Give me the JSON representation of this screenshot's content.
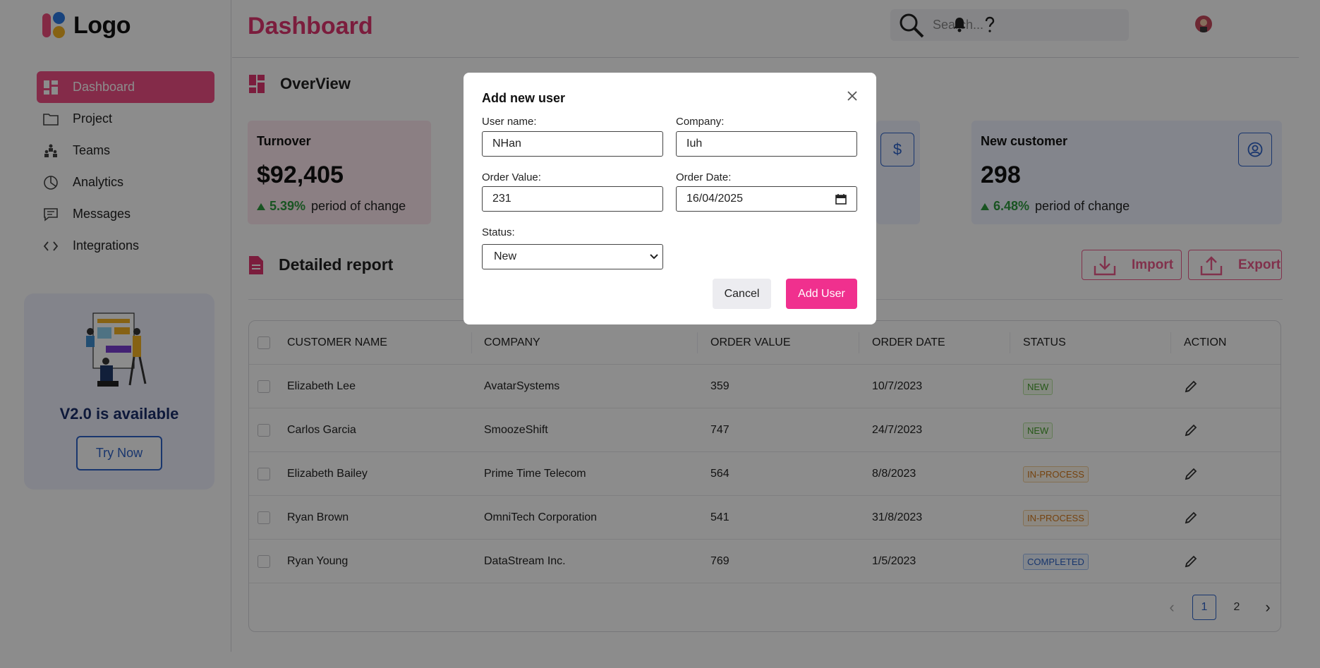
{
  "logo": {
    "text": "Logo"
  },
  "sidebar": {
    "items": [
      {
        "label": "Dashboard",
        "icon": "grid-icon"
      },
      {
        "label": "Project",
        "icon": "folder-icon"
      },
      {
        "label": "Teams",
        "icon": "teams-icon"
      },
      {
        "label": "Analytics",
        "icon": "pie-chart-icon"
      },
      {
        "label": "Messages",
        "icon": "message-icon"
      },
      {
        "label": "Integrations",
        "icon": "code-icon"
      }
    ],
    "promo": {
      "title": "V2.0 is available",
      "button": "Try Now"
    }
  },
  "header": {
    "title": "Dashboard",
    "search_placeholder": "Search..."
  },
  "overview": {
    "title": "OverView",
    "cards": [
      {
        "title": "Turnover",
        "value": "$92,405",
        "change": "5.39%",
        "change_text": "period of change"
      },
      {
        "title": "New customer",
        "value": "298",
        "change": "6.48%",
        "change_text": "period of change"
      }
    ],
    "dollar_symbol": "$"
  },
  "report": {
    "title": "Detailed report",
    "import_label": "Import",
    "export_label": "Export",
    "columns": [
      "CUSTOMER NAME",
      "COMPANY",
      "ORDER VALUE",
      "ORDER DATE",
      "STATUS",
      "ACTION"
    ],
    "rows": [
      {
        "name": "Elizabeth Lee",
        "company": "AvatarSystems",
        "value": "359",
        "date": "10/7/2023",
        "status": "NEW"
      },
      {
        "name": "Carlos Garcia",
        "company": "SmoozeShift",
        "value": "747",
        "date": "24/7/2023",
        "status": "NEW"
      },
      {
        "name": "Elizabeth Bailey",
        "company": "Prime Time Telecom",
        "value": "564",
        "date": "8/8/2023",
        "status": "IN-PROCESS"
      },
      {
        "name": "Ryan Brown",
        "company": "OmniTech Corporation",
        "value": "541",
        "date": "31/8/2023",
        "status": "IN-PROCESS"
      },
      {
        "name": "Ryan Young",
        "company": "DataStream Inc.",
        "value": "769",
        "date": "1/5/2023",
        "status": "COMPLETED"
      }
    ],
    "pagination": {
      "pages": [
        "1",
        "2"
      ],
      "current": "1",
      "prev": "‹",
      "next": "›"
    }
  },
  "modal": {
    "title": "Add new user",
    "close_glyph": "×",
    "username_label": "User name:",
    "username_value": "NHan",
    "company_label": "Company:",
    "company_value": "Iuh",
    "order_value_label": "Order Value:",
    "order_value_value": "231",
    "order_date_label": "Order Date:",
    "order_date_value": "16/04/2025",
    "status_label": "Status:",
    "status_value": "New",
    "cancel_label": "Cancel",
    "add_label": "Add User"
  },
  "colors": {
    "accent": "#f04f85",
    "brand_blue": "#2f63c8",
    "add_button": "#f0308e",
    "positive": "#2f9a3f"
  }
}
